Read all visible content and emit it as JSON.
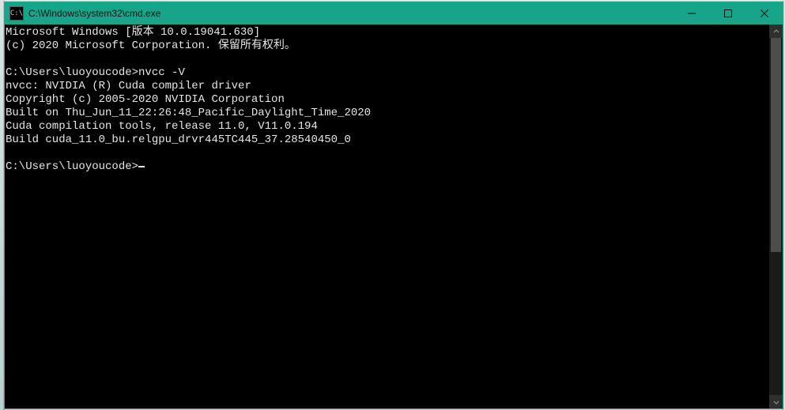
{
  "titlebar": {
    "icon_label": "C:\\",
    "title": "C:\\Windows\\system32\\cmd.exe"
  },
  "terminal": {
    "line1": "Microsoft Windows [版本 10.0.19041.630]",
    "line2": "(c) 2020 Microsoft Corporation. 保留所有权利。",
    "blank1": "",
    "prompt1_path": "C:\\Users\\luoyoucode>",
    "prompt1_cmd": "nvcc -V",
    "out1": "nvcc: NVIDIA (R) Cuda compiler driver",
    "out2": "Copyright (c) 2005-2020 NVIDIA Corporation",
    "out3": "Built on Thu_Jun_11_22:26:48_Pacific_Daylight_Time_2020",
    "out4": "Cuda compilation tools, release 11.0, V11.0.194",
    "out5": "Build cuda_11.0_bu.relgpu_drvr445TC445_37.28540450_0",
    "blank2": "",
    "prompt2_path": "C:\\Users\\luoyoucode>"
  }
}
